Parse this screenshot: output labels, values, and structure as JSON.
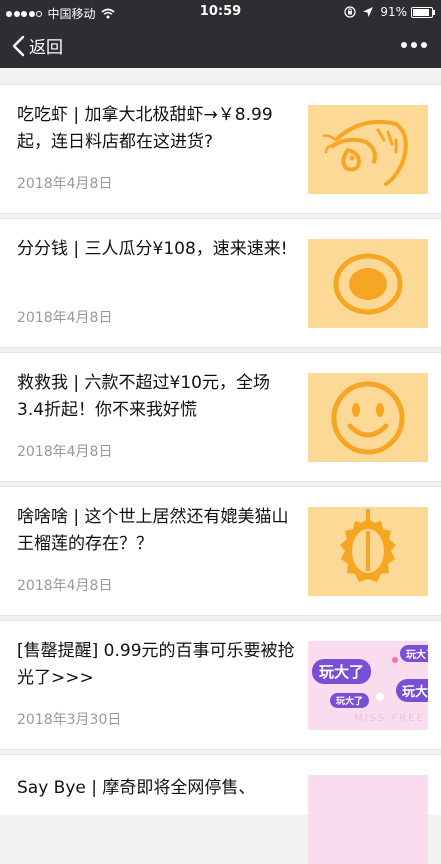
{
  "status_bar": {
    "carrier": "中国移动",
    "time": "10:59",
    "battery": "91%",
    "battery_level": 0.91
  },
  "nav": {
    "back_label": "返回"
  },
  "articles": [
    {
      "title": "吃吃虾 | 加拿大北极甜虾→￥8.99起，连日料店都在这进货?",
      "date": "2018年4月8日",
      "thumb_icon": "shrimp-icon"
    },
    {
      "title": "分分钱 | 三人瓜分¥108，速来速来!",
      "date": "2018年4月8日",
      "thumb_icon": "coin-icon"
    },
    {
      "title": "救救我 | 六款不超过¥10元，全场3.4折起！你不来我好慌",
      "date": "2018年4月8日",
      "thumb_icon": "smiley-icon"
    },
    {
      "title": "啥啥啥 | 这个世上居然还有媲美猫山王榴莲的存在？？",
      "date": "2018年4月8日",
      "thumb_icon": "durian-icon"
    },
    {
      "title": "[售罄提醒] 0.99元的百事可乐要被抢光了>>>",
      "date": "2018年3月30日",
      "thumb_icon": "play-big-banner",
      "thumb_texts": [
        "玩大了",
        "玩大了",
        "玩大了",
        "玩大了",
        "MISS FREE"
      ]
    },
    {
      "title": "Say Bye | 摩奇即将全网停售、",
      "date": "",
      "thumb_icon": "pink-banner"
    }
  ],
  "colors": {
    "bar": "#2e2e32",
    "thumb_yellow": "#fdd998",
    "icon_orange": "#f6a623",
    "thumb_pink": "#fadcef",
    "pill_purple": "#7a4fd8"
  }
}
